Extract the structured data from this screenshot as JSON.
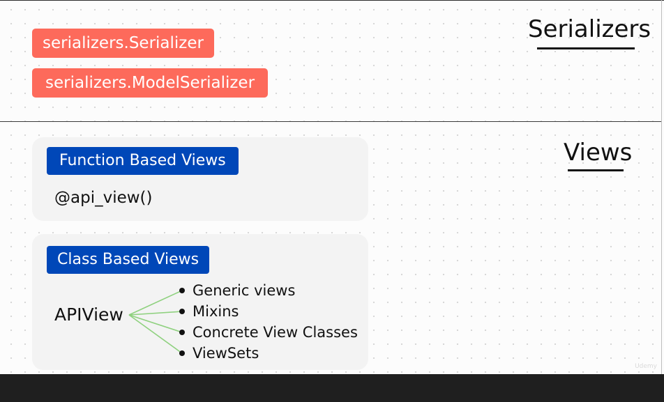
{
  "serializers": {
    "title": "Serializers",
    "items": [
      "serializers.Serializer",
      "serializers.ModelSerializer"
    ]
  },
  "views": {
    "title": "Views",
    "function_based": {
      "label": "Function Based Views",
      "decorator": "@api_view()"
    },
    "class_based": {
      "label": "Class Based Views",
      "root": "APIView",
      "children": [
        "Generic views",
        "Mixins",
        "Concrete View Classes",
        "ViewSets"
      ]
    }
  },
  "watermark": "Udemy",
  "colors": {
    "serializer_tag": "#fd6a5b",
    "view_tag": "#0047b8",
    "connector": "#8fd17f",
    "card_background": "#f3f3f3",
    "footer_bar": "#1f1f1f"
  }
}
